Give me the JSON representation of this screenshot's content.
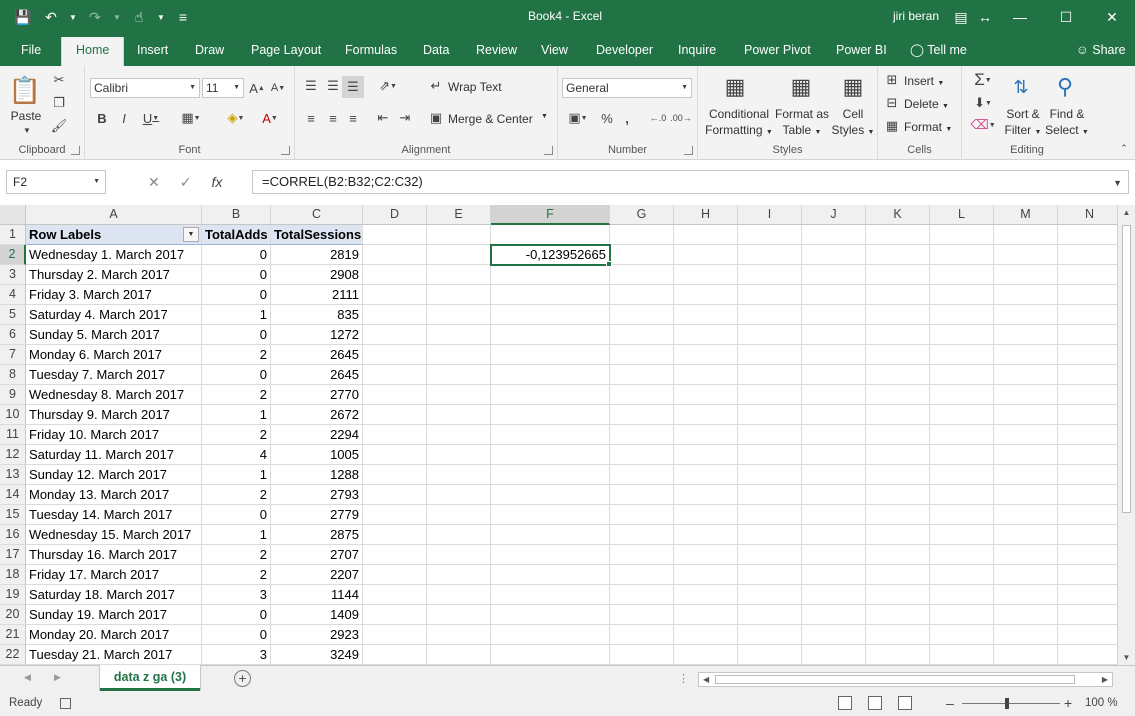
{
  "window": {
    "title": "Book4  -  Excel",
    "user": "jiri beran"
  },
  "tabs": [
    "File",
    "Home",
    "Insert",
    "Draw",
    "Page Layout",
    "Formulas",
    "Data",
    "Review",
    "View",
    "Developer",
    "Inquire",
    "Power Pivot",
    "Power BI"
  ],
  "tell_me": "Tell me",
  "share": "Share",
  "ribbon": {
    "clipboard": {
      "label": "Clipboard",
      "paste": "Paste"
    },
    "font": {
      "label": "Font",
      "name": "Calibri",
      "size": "11"
    },
    "alignment": {
      "label": "Alignment",
      "wrap": "Wrap Text",
      "merge": "Merge & Center"
    },
    "number": {
      "label": "Number",
      "format": "General"
    },
    "styles": {
      "label": "Styles",
      "conditional_1": "Conditional",
      "conditional_2": "Formatting",
      "format_table_1": "Format as",
      "format_table_2": "Table",
      "cell_styles_1": "Cell",
      "cell_styles_2": "Styles"
    },
    "cells": {
      "label": "Cells",
      "insert": "Insert",
      "delete": "Delete",
      "format": "Format"
    },
    "editing": {
      "label": "Editing",
      "sort_1": "Sort &",
      "sort_2": "Filter",
      "find_1": "Find &",
      "find_2": "Select"
    }
  },
  "formula_bar": {
    "name_box": "F2",
    "formula": "=CORREL(B2:B32;C2:C32)"
  },
  "columns": [
    "A",
    "B",
    "C",
    "D",
    "E",
    "F",
    "G",
    "H",
    "I",
    "J",
    "K",
    "L",
    "M",
    "N"
  ],
  "header_row": {
    "a": "Row Labels",
    "b": "TotalAdds",
    "c": "TotalSessions"
  },
  "rows": [
    {
      "n": "2",
      "a": "Wednesday 1. March 2017",
      "b": "0",
      "c": "2819"
    },
    {
      "n": "3",
      "a": "Thursday 2. March 2017",
      "b": "0",
      "c": "2908"
    },
    {
      "n": "4",
      "a": "Friday 3. March 2017",
      "b": "0",
      "c": "2111"
    },
    {
      "n": "5",
      "a": "Saturday 4. March 2017",
      "b": "1",
      "c": "835"
    },
    {
      "n": "6",
      "a": "Sunday 5. March 2017",
      "b": "0",
      "c": "1272"
    },
    {
      "n": "7",
      "a": "Monday 6. March 2017",
      "b": "2",
      "c": "2645"
    },
    {
      "n": "8",
      "a": "Tuesday 7. March 2017",
      "b": "0",
      "c": "2645"
    },
    {
      "n": "9",
      "a": "Wednesday 8. March 2017",
      "b": "2",
      "c": "2770"
    },
    {
      "n": "10",
      "a": "Thursday 9. March 2017",
      "b": "1",
      "c": "2672"
    },
    {
      "n": "11",
      "a": "Friday 10. March 2017",
      "b": "2",
      "c": "2294"
    },
    {
      "n": "12",
      "a": "Saturday 11. March 2017",
      "b": "4",
      "c": "1005"
    },
    {
      "n": "13",
      "a": "Sunday 12. March 2017",
      "b": "1",
      "c": "1288"
    },
    {
      "n": "14",
      "a": "Monday 13. March 2017",
      "b": "2",
      "c": "2793"
    },
    {
      "n": "15",
      "a": "Tuesday 14. March 2017",
      "b": "0",
      "c": "2779"
    },
    {
      "n": "16",
      "a": "Wednesday 15. March 2017",
      "b": "1",
      "c": "2875"
    },
    {
      "n": "17",
      "a": "Thursday 16. March 2017",
      "b": "2",
      "c": "2707"
    },
    {
      "n": "18",
      "a": "Friday 17. March 2017",
      "b": "2",
      "c": "2207"
    },
    {
      "n": "19",
      "a": "Saturday 18. March 2017",
      "b": "3",
      "c": "1144"
    },
    {
      "n": "20",
      "a": "Sunday 19. March 2017",
      "b": "0",
      "c": "1409"
    },
    {
      "n": "21",
      "a": "Monday 20. March 2017",
      "b": "0",
      "c": "2923"
    },
    {
      "n": "22",
      "a": "Tuesday 21. March 2017",
      "b": "3",
      "c": "3249"
    }
  ],
  "f2_value": "-0,123952665",
  "sheet_tab": "data z ga (3)",
  "status": {
    "ready": "Ready",
    "zoom": "100 %"
  },
  "colors": {
    "accent": "#217346",
    "pivot_header": "#dde5f2"
  }
}
